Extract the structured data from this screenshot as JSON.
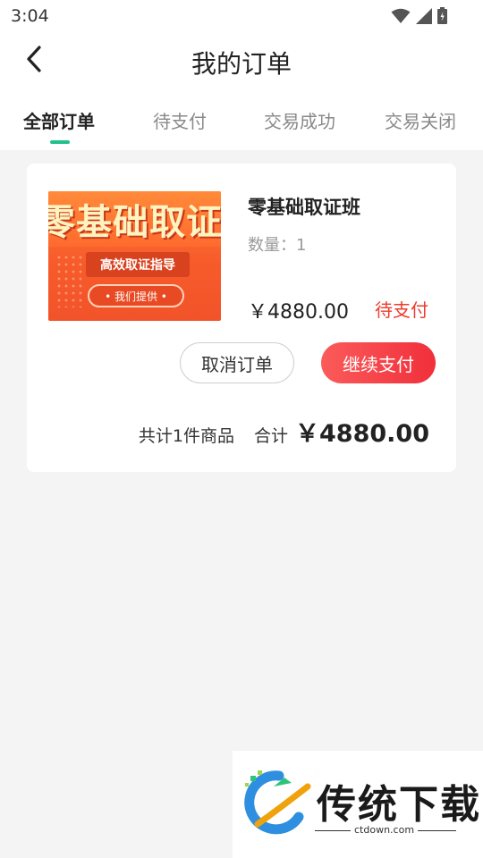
{
  "status_bar": {
    "time": "3:04",
    "icons": [
      "wifi-icon",
      "signal-icon",
      "battery-icon"
    ]
  },
  "header": {
    "title": "我的订单",
    "back_icon": "chevron-left-icon"
  },
  "tabs": [
    {
      "label": "全部订单",
      "active": true
    },
    {
      "label": "待支付",
      "active": false
    },
    {
      "label": "交易成功",
      "active": false
    },
    {
      "label": "交易关闭",
      "active": false
    }
  ],
  "order": {
    "image": {
      "headline": "零基础取证班",
      "ribbon": "高效取证指导",
      "pill": "• 我们提供 •"
    },
    "product_name": "零基础取证班",
    "quantity_label": "数量：",
    "quantity": "1",
    "price": "￥4880.00",
    "status": "待支付",
    "cancel_label": "取消订单",
    "pay_label": "继续支付",
    "summary_count": "共计1件商品",
    "summary_label": "合计",
    "summary_total": "￥4880.00"
  },
  "watermark": {
    "name": "传统下载",
    "url": "ctdown.com"
  },
  "colors": {
    "accent": "#23c08d",
    "pay_button": "#f12f3b",
    "status": "#ee3b2c",
    "background": "#f4f4f4"
  }
}
